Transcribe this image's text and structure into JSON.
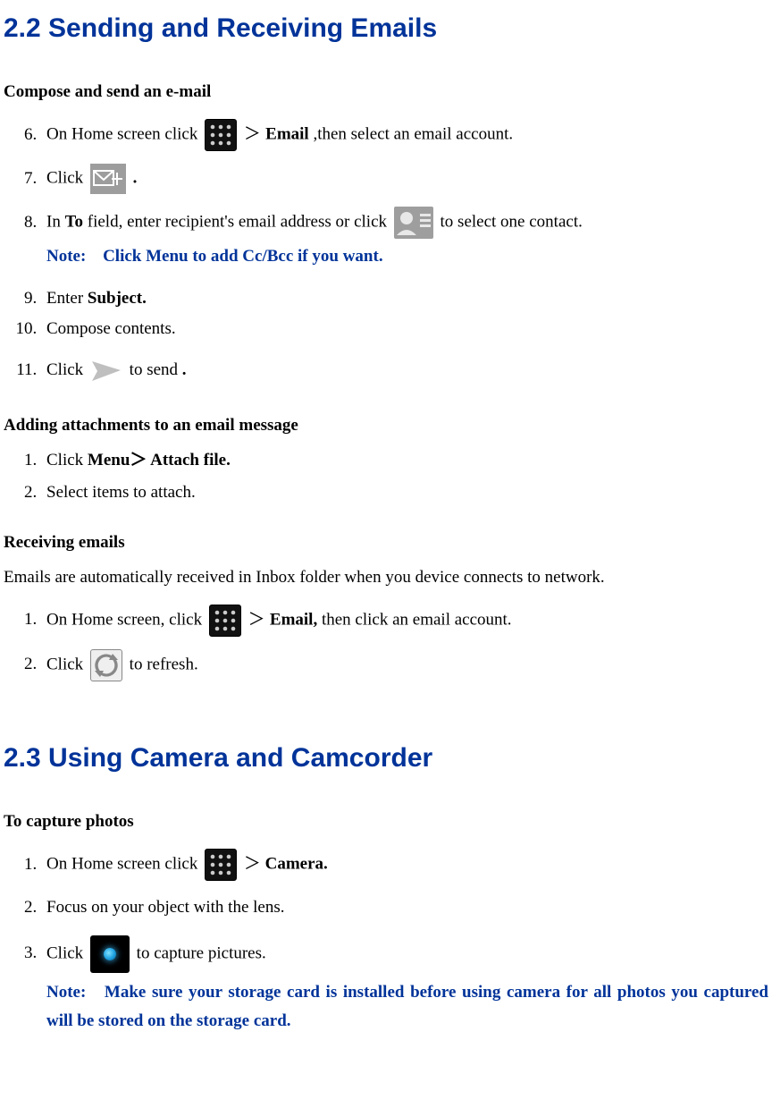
{
  "section22": {
    "heading": "2.2 Sending and Receiving Emails",
    "compose": {
      "title": "Compose and send an e-mail",
      "step6_a": "On Home screen click ",
      "step6_b": " ＞ ",
      "step6_c": "Email",
      "step6_d": " ,then select an email account.",
      "step7_a": "Click ",
      "step7_b": ".",
      "step8_a": "In ",
      "step8_b": "To",
      "step8_c": " field, enter recipient's email address or click ",
      "step8_d": " to select one contact.",
      "step8_note_label": "Note:",
      "step8_note": "Click Menu to add Cc/Bcc if you want.",
      "step9_a": "Enter ",
      "step9_b": "Subject.",
      "step10": "Compose contents.",
      "step11_a": "Click ",
      "step11_b": " to send",
      "step11_c": "."
    },
    "attach": {
      "title": "Adding attachments to an email message",
      "step1_a": "Click ",
      "step1_b": "Menu＞ Attach file.",
      "step2": "Select items to attach."
    },
    "receive": {
      "title": "Receiving emails",
      "intro": "Emails are automatically received in Inbox folder when you device connects to network.",
      "step1_a": "On Home screen, click ",
      "step1_b": " ＞ ",
      "step1_c": "Email,",
      "step1_d": " then click an email account.",
      "step2_a": "Click ",
      "step2_b": " to refresh."
    }
  },
  "section23": {
    "heading": "2.3 Using Camera and Camcorder",
    "capture": {
      "title": "To capture photos",
      "step1_a": "On Home screen click ",
      "step1_b": " ＞",
      "step1_c": "Camera.",
      "step2": "Focus on your object with the lens.",
      "step3_a": "Click  ",
      "step3_b": "  to capture pictures.",
      "note_label": "Note:",
      "note_body": "  Make sure your storage card is installed before using camera for all photos you captured will be stored on the storage card."
    }
  }
}
